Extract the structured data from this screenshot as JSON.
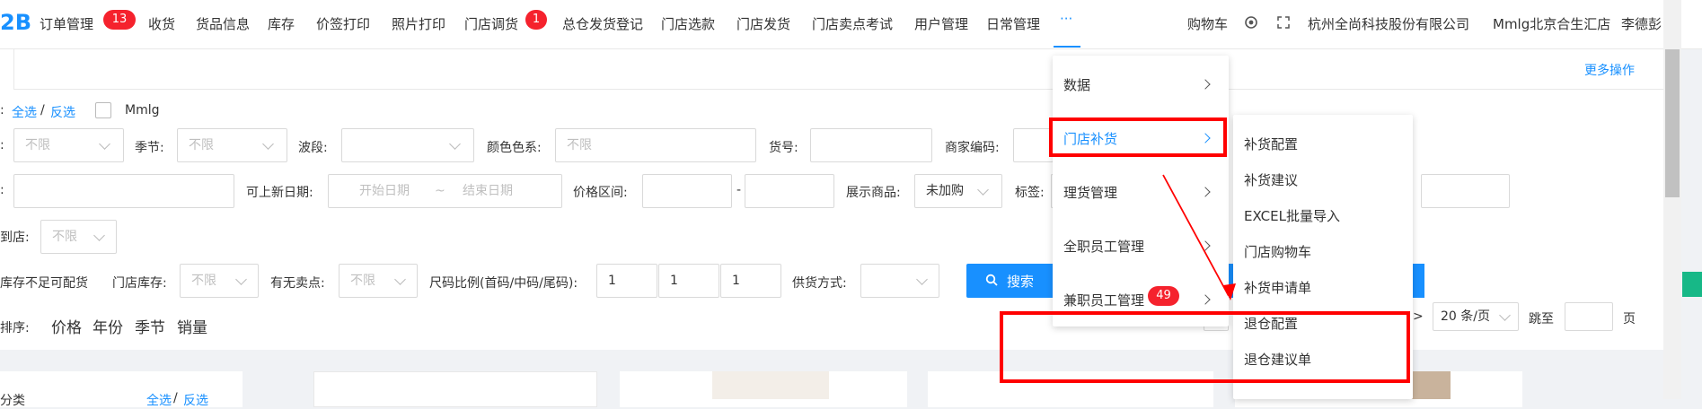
{
  "nav": {
    "brand": "2B",
    "items": [
      "订单管理",
      "收货",
      "货品信息",
      "库存",
      "价签打印",
      "照片打印",
      "门店调货",
      "总仓发货登记",
      "门店选款",
      "门店发货",
      "门店卖点考试",
      "用户管理",
      "日常管理"
    ],
    "badges": {
      "orders": "13",
      "transfer": "1"
    },
    "more": "···",
    "right": {
      "cart": "购物车",
      "company": "杭州全尚科技股份有限公司",
      "store": "Mmlg北京合生汇店",
      "user": "李德彭"
    }
  },
  "toolbar": {
    "more_ops": "更多操作"
  },
  "filters": {
    "brand_sep": ":",
    "select_all": "全选",
    "slash": "/",
    "invert": "反选",
    "brand_name": "Mmlg",
    "unlimited": "不限",
    "season_label": "季节:",
    "band_label": "波段:",
    "color_label": "颜色色系:",
    "color_placeholder": "不限",
    "sku_label": "货号:",
    "merchant_code_label": "商家编码:",
    "new_date_label": "可上新日期:",
    "start_date": "开始日期",
    "tilde": "~",
    "end_date": "结束日期",
    "price_label": "价格区间:",
    "dash": "-",
    "display_label": "展示商品:",
    "display_value": "未加购",
    "tag_label": "标签:",
    "arrive_label": "到店:",
    "stock_lack": "库存不足可配货",
    "store_stock_label": "门店库存:",
    "selling_point_label": "有无卖点:",
    "size_ratio_label": "尺码比例(首码/中码/尾码):",
    "size_values": [
      "1",
      "1",
      "1"
    ],
    "supply_label": "供货方式:",
    "search": "搜索",
    "sort_label": "排序:",
    "sort_options": [
      "价格",
      "年份",
      "季节",
      "销量"
    ],
    "page_size": "20 条/页",
    "jump_to": "跳至",
    "page_unit": "页",
    "pager_prev": "<",
    "pager_next": ">"
  },
  "side": {
    "category": "分类",
    "select_all": "全选",
    "invert": "反选"
  },
  "menu_level1": [
    {
      "label": "数据"
    },
    {
      "label": "门店补货"
    },
    {
      "label": "理货管理"
    },
    {
      "label": "全职员工管理"
    },
    {
      "label": "兼职员工管理",
      "badge": "49"
    }
  ],
  "menu_level2": [
    "补货配置",
    "补货建议",
    "EXCEL批量导入",
    "门店购物车",
    "补货申请单",
    "退仓配置",
    "退仓建议单"
  ],
  "colors": {
    "accent": "#1890ff",
    "badge": "#f5222d",
    "highlight": "#ff0000"
  }
}
